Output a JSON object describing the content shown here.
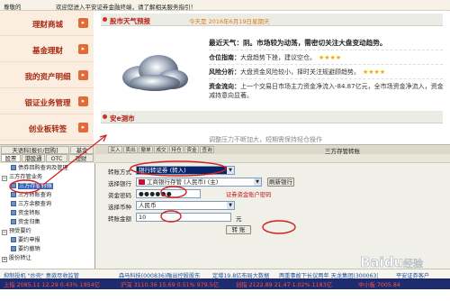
{
  "topbar": {
    "greeting_name": "尊敬的",
    "welcome": "欢迎您进入平安证券金融终端，请了解相关服务指引！"
  },
  "leftnav": {
    "items": [
      {
        "label": "理财商城"
      },
      {
        "label": "基金理财"
      },
      {
        "label": "我的资产明细"
      },
      {
        "label": "银证业务管理"
      },
      {
        "label": "创业板转签"
      }
    ],
    "button_glyph": "▸"
  },
  "weather_section": {
    "title": "股市天气预报",
    "date": "今天是 2016年6月19日",
    "weekday": "星期天",
    "headline_label": "最近天气：",
    "headline": "阴。市场较为动荡，需密切关注大盘变动趋势。",
    "lines": [
      {
        "label": "仓位指南：",
        "text": "大盘趋势下挫，建议空仓。",
        "stars": "★★★★"
      },
      {
        "label": "风险分析：",
        "text": "大盘资金风险较小，择时关注规避顾趋势。",
        "stars": "★★★★"
      },
      {
        "label": "资金流向：",
        "text": "上一个交易日市场主力资金净流入-84.87亿元，全市场资金净流入，资金减持意向显著。",
        "stars": ""
      }
    ]
  },
  "second_section": {
    "title": "安e测市",
    "snippet": "调整压力不断加大，短期需保持轻仓操作"
  },
  "app": {
    "left_tabs": [
      "天语科[报价/回购]",
      "基金",
      "股票",
      "港股通",
      "OTC",
      "理财"
    ],
    "tree": [
      {
        "label": "债券回购查询及管理",
        "type": "item"
      },
      {
        "label": "三方存管业务",
        "type": "group"
      },
      {
        "label": "三方存管转账",
        "type": "item",
        "selected": true
      },
      {
        "label": "三方转账查询",
        "type": "item"
      },
      {
        "label": "三方余额查询",
        "type": "item"
      },
      {
        "label": "资金转账",
        "type": "item"
      },
      {
        "label": "资金归集",
        "type": "item"
      },
      {
        "label": "预受要约",
        "type": "group"
      },
      {
        "label": "要约申报",
        "type": "item"
      },
      {
        "label": "要约撤销",
        "type": "item"
      },
      {
        "label": "股份转让",
        "type": "group"
      }
    ],
    "right_tabs": [
      "买入",
      "卖出",
      "撤单",
      "成交",
      "持仓",
      "资金",
      "查询"
    ],
    "panel_title": "三方存管转账",
    "form": {
      "direction_label": "转账方式",
      "direction_value": "银行转证券 (转入)",
      "bank_label": "选择银行",
      "bank_value": "工商银行存管 (人民币) (主)",
      "refresh_bank_button": "刷新银行",
      "password_label": "资金密码",
      "password_value": "●●●●●●",
      "password_link": "证券资金账户密码",
      "currency_label": "选择币种",
      "currency_value": "人民币",
      "amount_label": "转账金额",
      "amount_value": "10",
      "amount_unit": "元",
      "submit_button": "转 账"
    }
  },
  "newsbar": {
    "items": [
      "抑制投机 \"炒壳\" 意欲尽收监管",
      "森马科技(000836)融出控股股东",
      "定增19.8亿布局大数据",
      "两重事故下长议两年 天龙集团(300063)暂停公司重大事",
      "平安证券客户"
    ]
  },
  "quotebar": {
    "items": [
      "上指 2085.11  12.29  0.43%  1954亿",
      "沪深 3110.36  15.69  0.51%  979.5亿",
      "创指 2122.89  21.47  1.02%  1183亿",
      "中小板 7005.84"
    ]
  },
  "watermark": "Baidu 经验"
}
